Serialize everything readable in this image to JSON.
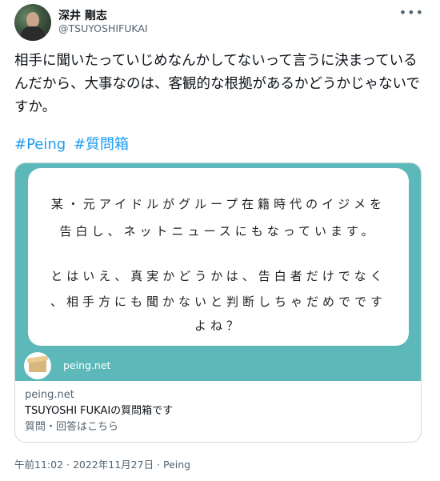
{
  "author": {
    "display_name": "深井 剛志",
    "handle": "@TSUYOSHIFUKAI"
  },
  "menu_glyph": "•••",
  "tweet": {
    "text": "相手に聞いたっていじめなんかしてないって言うに決まっているんだから、大事なのは、客観的な根拠があるかどうかじゃないですか。",
    "hashtags": [
      "#Peing",
      "#質問箱"
    ]
  },
  "card": {
    "question_lines": [
      "某・元アイドルがグループ在籍時代のイジメを",
      "告白し、ネットニュースにもなっています。",
      "",
      "とはいえ、真実かどうかは、告白者だけでなく",
      "、相手方にも聞かないと判断しちゃだめでです",
      "よね？"
    ],
    "site_label": "peing.net",
    "domain": "peing.net",
    "title": "TSUYOSHI FUKAIの質問箱です",
    "description": "質問・回答はこちら"
  },
  "footer": {
    "time": "午前11:02",
    "separator1": " · ",
    "date": "2022年11月27日",
    "separator2": " · ",
    "source": "Peing"
  },
  "colors": {
    "link": "#1d9bf0",
    "card_bg": "#5db8b9",
    "secondary_text": "#536471"
  }
}
